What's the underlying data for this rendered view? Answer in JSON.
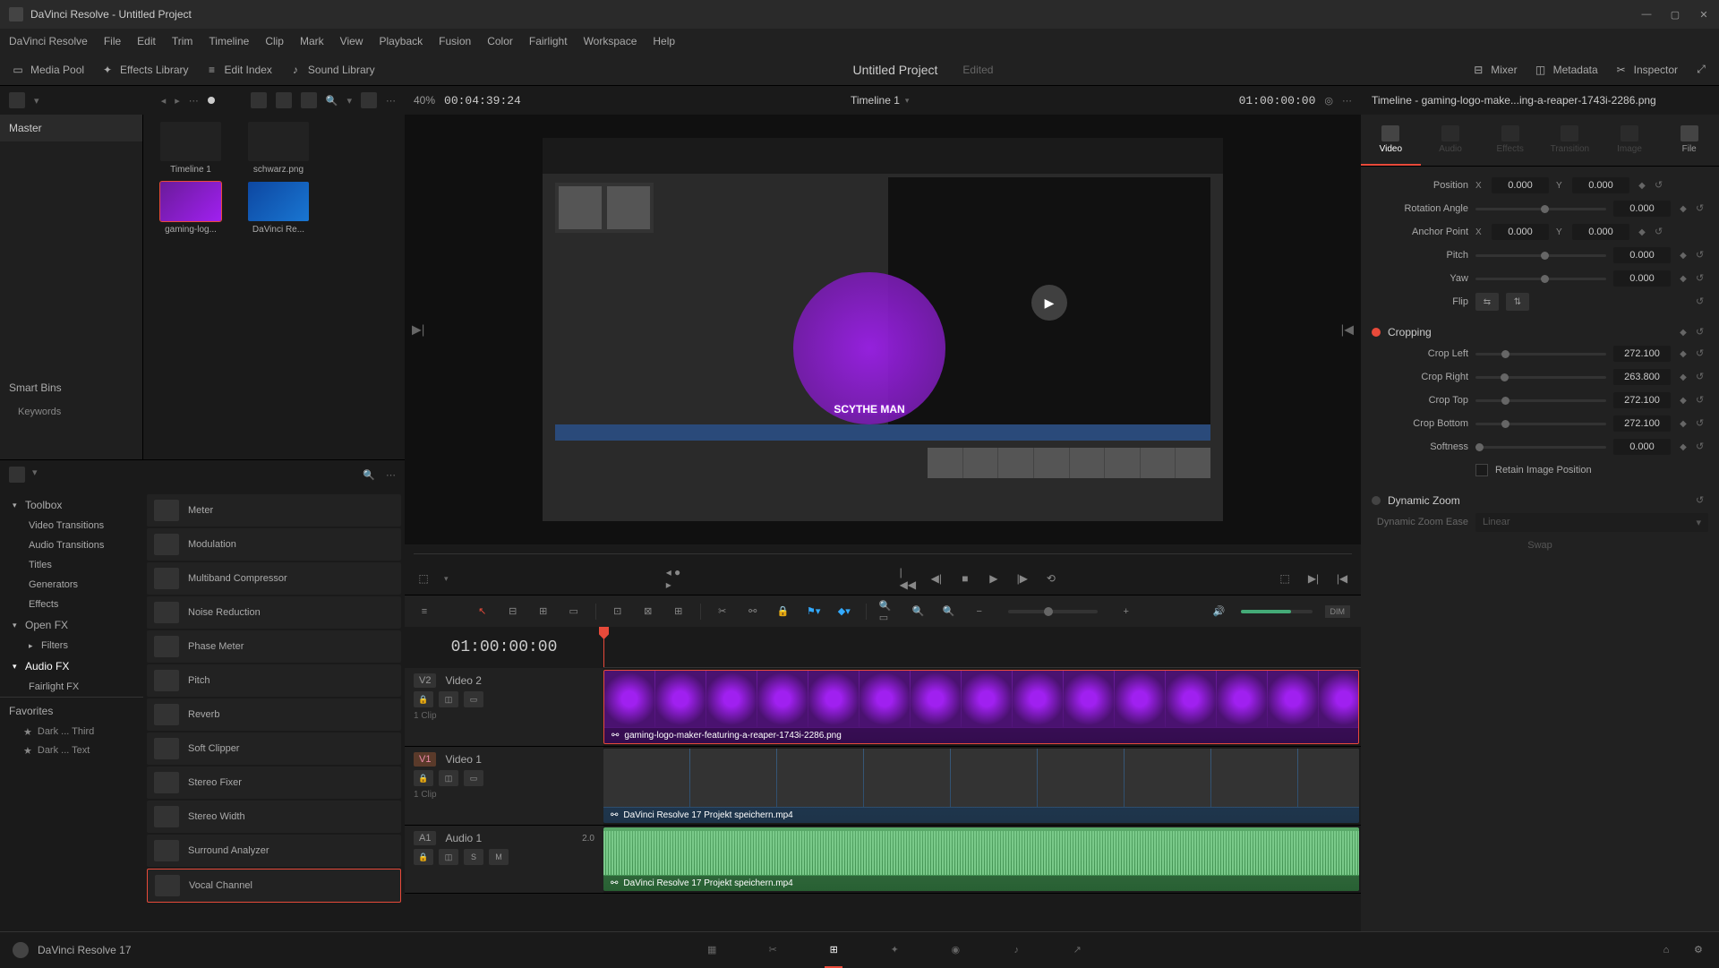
{
  "titlebar": {
    "title": "DaVinci Resolve - Untitled Project"
  },
  "menu": [
    "DaVinci Resolve",
    "File",
    "Edit",
    "Trim",
    "Timeline",
    "Clip",
    "Mark",
    "View",
    "Playback",
    "Fusion",
    "Color",
    "Fairlight",
    "Workspace",
    "Help"
  ],
  "toolbar": {
    "media_pool": "Media Pool",
    "effects_library": "Effects Library",
    "edit_index": "Edit Index",
    "sound_library": "Sound Library",
    "mixer": "Mixer",
    "metadata": "Metadata",
    "inspector": "Inspector",
    "project_name": "Untitled Project",
    "project_edited": "Edited"
  },
  "viewer": {
    "zoom": "40%",
    "tc_left": "00:04:39:24",
    "timeline_name": "Timeline 1",
    "tc_right": "01:00:00:00"
  },
  "media": {
    "master": "Master",
    "smart_bins": "Smart Bins",
    "keywords": "Keywords",
    "clips": [
      {
        "label": "Timeline 1",
        "kind": "dark"
      },
      {
        "label": "schwarz.png",
        "kind": "dark"
      },
      {
        "label": "gaming-log...",
        "kind": "purple"
      },
      {
        "label": "DaVinci Re...",
        "kind": "blue"
      }
    ]
  },
  "fx": {
    "tree": [
      {
        "label": "Toolbox",
        "arrow": true,
        "sub": false
      },
      {
        "label": "Video Transitions",
        "sub": true
      },
      {
        "label": "Audio Transitions",
        "sub": true
      },
      {
        "label": "Titles",
        "sub": true
      },
      {
        "label": "Generators",
        "sub": true
      },
      {
        "label": "Effects",
        "sub": true
      },
      {
        "label": "Open FX",
        "arrow": true,
        "sub": false
      },
      {
        "label": "Filters",
        "arrow": true,
        "sub": true
      },
      {
        "label": "Audio FX",
        "arrow": true,
        "sub": false,
        "active": true
      },
      {
        "label": "Fairlight FX",
        "sub": true
      }
    ],
    "list": [
      "Meter",
      "Modulation",
      "Multiband Compressor",
      "Noise Reduction",
      "Phase Meter",
      "Pitch",
      "Reverb",
      "Soft Clipper",
      "Stereo Fixer",
      "Stereo Width",
      "Surround Analyzer",
      "Vocal Channel"
    ],
    "favorites_hdr": "Favorites",
    "favorites": [
      "Dark ... Third",
      "Dark ... Text"
    ]
  },
  "timeline": {
    "tc": "01:00:00:00",
    "tracks": {
      "v2": {
        "id": "V2",
        "name": "Video 2",
        "count": "1 Clip",
        "clip_label": "gaming-logo-maker-featuring-a-reaper-1743i-2286.png"
      },
      "v1": {
        "id": "V1",
        "name": "Video 1",
        "count": "1 Clip",
        "clip_label": "DaVinci Resolve 17 Projekt speichern.mp4"
      },
      "a1": {
        "id": "A1",
        "name": "Audio 1",
        "ch": "2.0",
        "clip_label": "DaVinci Resolve 17 Projekt speichern.mp4",
        "solo": "S",
        "mute": "M"
      }
    }
  },
  "inspector": {
    "header": "Timeline - gaming-logo-make...ing-a-reaper-1743i-2286.png",
    "tabs": [
      "Video",
      "Audio",
      "Effects",
      "Transition",
      "Image",
      "File"
    ],
    "position": {
      "label": "Position",
      "x": "0.000",
      "y": "0.000"
    },
    "rotation": {
      "label": "Rotation Angle",
      "val": "0.000"
    },
    "anchor": {
      "label": "Anchor Point",
      "x": "0.000",
      "y": "0.000"
    },
    "pitch": {
      "label": "Pitch",
      "val": "0.000"
    },
    "yaw": {
      "label": "Yaw",
      "val": "0.000"
    },
    "flip": {
      "label": "Flip"
    },
    "cropping": {
      "label": "Cropping",
      "left": {
        "label": "Crop Left",
        "val": "272.100"
      },
      "right": {
        "label": "Crop Right",
        "val": "263.800"
      },
      "top": {
        "label": "Crop Top",
        "val": "272.100"
      },
      "bottom": {
        "label": "Crop Bottom",
        "val": "272.100"
      },
      "soft": {
        "label": "Softness",
        "val": "0.000"
      },
      "retain": "Retain Image Position"
    },
    "dzoom": {
      "label": "Dynamic Zoom",
      "ease_label": "Dynamic Zoom Ease",
      "ease_val": "Linear",
      "swap": "Swap"
    }
  },
  "bottombar": {
    "app": "DaVinci Resolve 17"
  }
}
